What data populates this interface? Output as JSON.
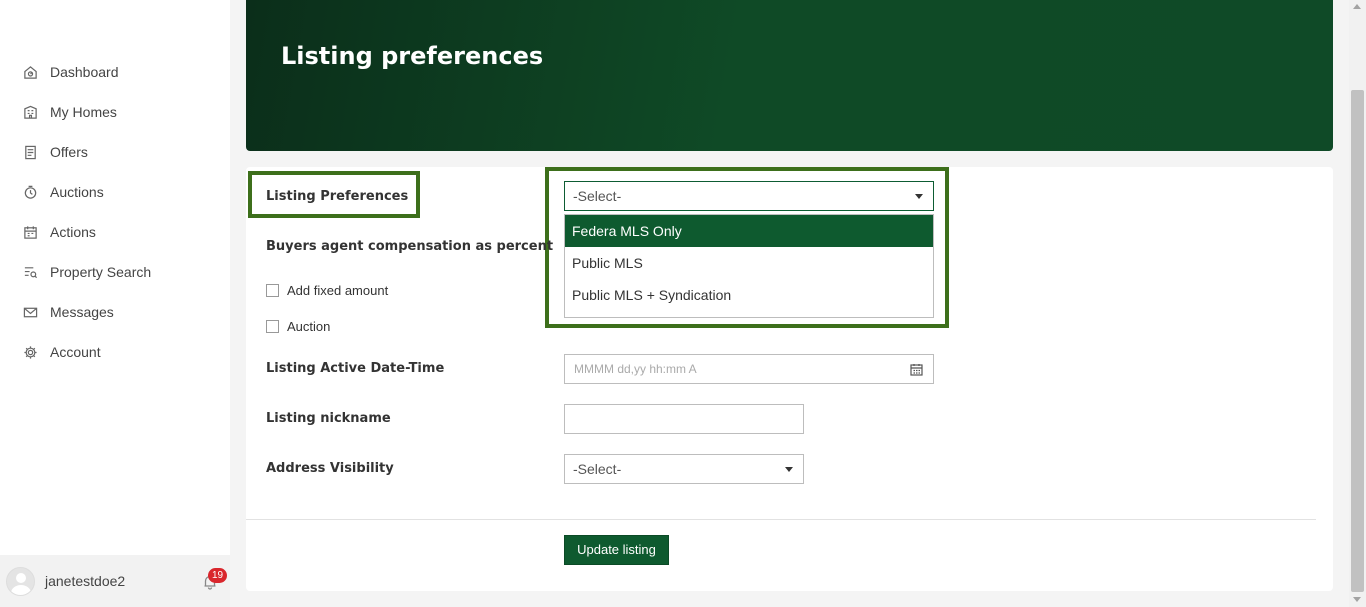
{
  "sidebar": {
    "items": [
      {
        "label": "Dashboard",
        "icon": "dashboard-icon"
      },
      {
        "label": "My Homes",
        "icon": "home-icon"
      },
      {
        "label": "Offers",
        "icon": "document-icon"
      },
      {
        "label": "Auctions",
        "icon": "auction-icon"
      },
      {
        "label": "Actions",
        "icon": "calendar-icon"
      },
      {
        "label": "Property Search",
        "icon": "search-list-icon"
      },
      {
        "label": "Messages",
        "icon": "mail-icon"
      },
      {
        "label": "Account",
        "icon": "gear-icon"
      }
    ],
    "user": {
      "name": "janetestdoe2",
      "notifications": "19"
    }
  },
  "header": {
    "title": "Listing preferences"
  },
  "form": {
    "listing_preferences": {
      "label": "Listing Preferences",
      "placeholder": "-Select-",
      "options": [
        "Federa MLS Only",
        "Public MLS",
        "Public MLS + Syndication"
      ],
      "highlighted_option": "Federa MLS Only"
    },
    "buyers_agent": {
      "label": "Buyers agent compensation as percent"
    },
    "add_fixed_amount": {
      "label": "Add fixed amount"
    },
    "auction": {
      "label": "Auction"
    },
    "listing_active": {
      "label": "Listing Active Date-Time",
      "placeholder": "MMMM dd,yy hh:mm A"
    },
    "nickname": {
      "label": "Listing nickname",
      "value": ""
    },
    "address_visibility": {
      "label": "Address Visibility",
      "value": "-Select-"
    },
    "submit_label": "Update listing"
  },
  "colors": {
    "accent": "#0e5a2f",
    "highlight_border": "#3d6f1b",
    "badge": "#d9262c"
  }
}
